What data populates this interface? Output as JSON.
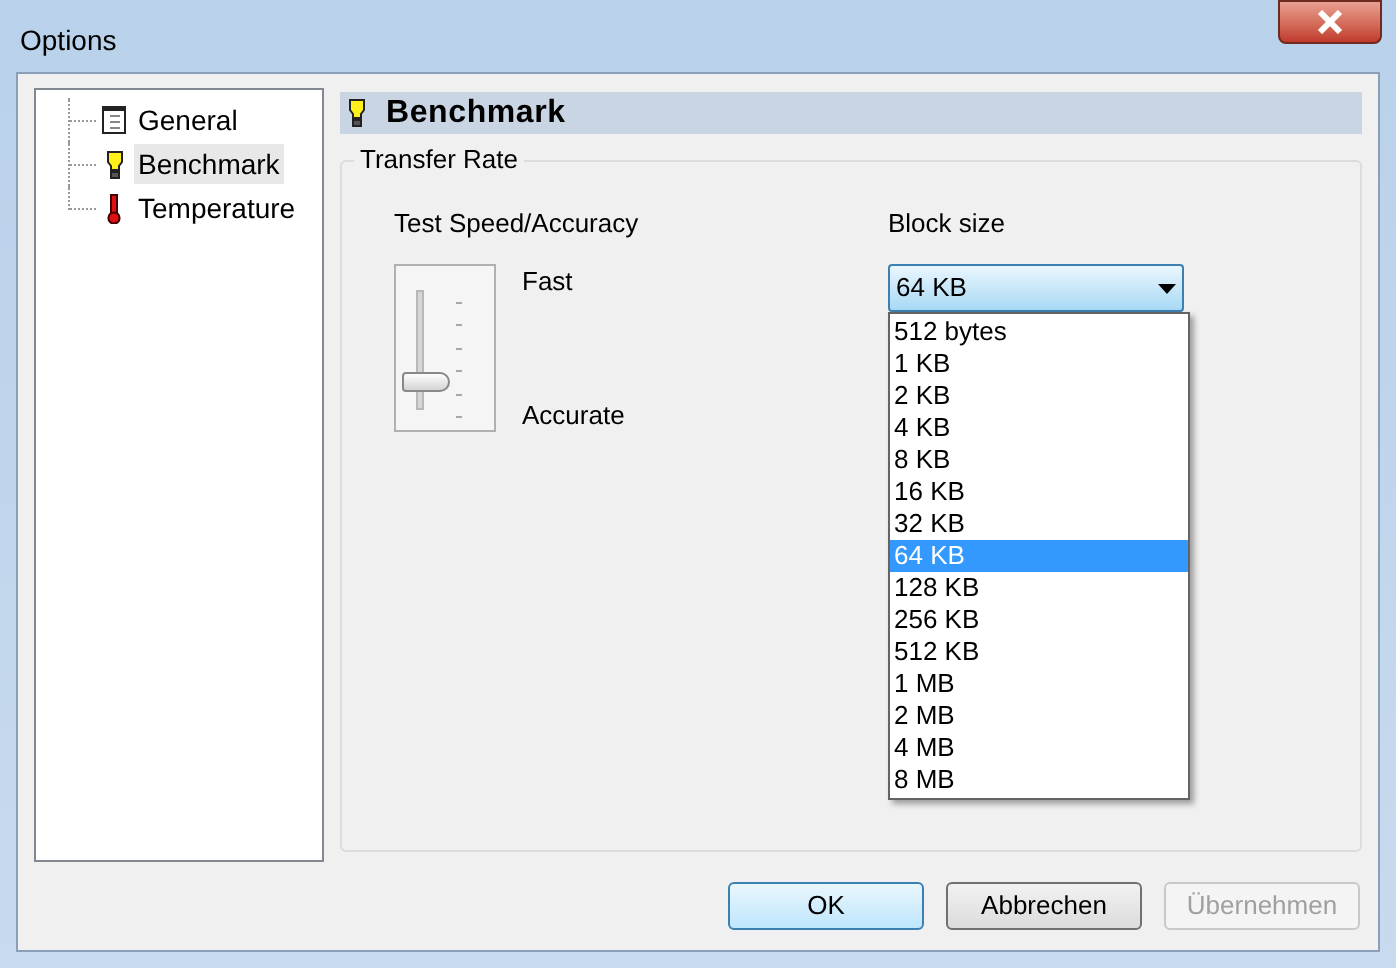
{
  "window": {
    "title": "Options"
  },
  "tree": {
    "items": [
      {
        "label": "General",
        "kind": "page",
        "selected": false
      },
      {
        "label": "Benchmark",
        "kind": "bulb",
        "selected": true
      },
      {
        "label": "Temperature",
        "kind": "thermometer",
        "selected": false
      }
    ]
  },
  "page": {
    "title": "Benchmark",
    "kind": "bulb"
  },
  "group": {
    "title": "Transfer Rate"
  },
  "speed": {
    "label": "Test Speed/Accuracy",
    "top_label": "Fast",
    "bottom_label": "Accurate",
    "level": 0.3
  },
  "block_size": {
    "label": "Block size",
    "value": "64 KB",
    "expanded": true,
    "options": [
      {
        "label": "512 bytes",
        "selected": false
      },
      {
        "label": "1 KB",
        "selected": false
      },
      {
        "label": "2 KB",
        "selected": false
      },
      {
        "label": "4 KB",
        "selected": false
      },
      {
        "label": "8 KB",
        "selected": false
      },
      {
        "label": "16 KB",
        "selected": false
      },
      {
        "label": "32 KB",
        "selected": false
      },
      {
        "label": "64 KB",
        "selected": true
      },
      {
        "label": "128 KB",
        "selected": false
      },
      {
        "label": "256 KB",
        "selected": false
      },
      {
        "label": "512 KB",
        "selected": false
      },
      {
        "label": "1 MB",
        "selected": false
      },
      {
        "label": "2 MB",
        "selected": false
      },
      {
        "label": "4 MB",
        "selected": false
      },
      {
        "label": "8 MB",
        "selected": false
      }
    ]
  },
  "buttons": [
    {
      "label": "OK",
      "kind": "default",
      "disabled": false
    },
    {
      "label": "Abbrechen",
      "kind": "normal",
      "disabled": false
    },
    {
      "label": "Übernehmen",
      "kind": "normal",
      "disabled": true
    }
  ]
}
